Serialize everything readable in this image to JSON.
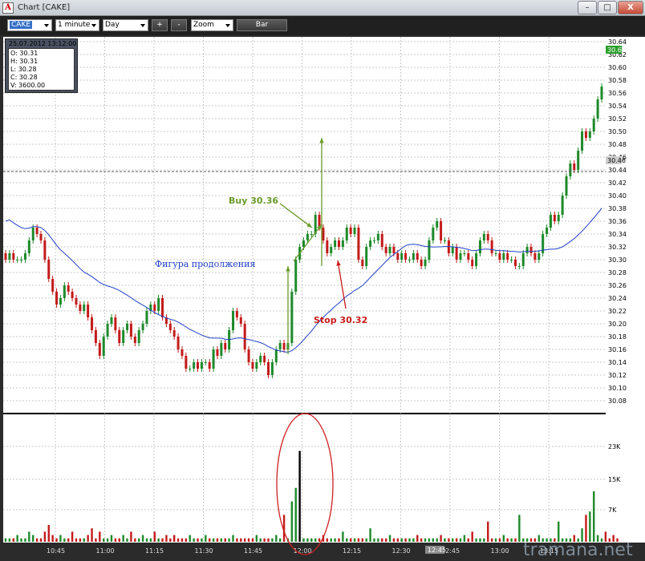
{
  "window": {
    "title": "Chart [CAKE]",
    "app_letter": "A",
    "min": "–",
    "max": "□",
    "close": "X"
  },
  "toolbar": {
    "symbol": "CAKE",
    "interval": "1 minute",
    "range": "Day",
    "plus": "+",
    "minus": "-",
    "zoom": "Zoom",
    "bar": "Bar"
  },
  "info": {
    "timestamp": "25.07.2012 13:12:00",
    "open": "O: 30.31",
    "high": "H: 30.31",
    "low": "L: 30.28",
    "close": "C: 30.28",
    "volume": "V: 3600.00"
  },
  "annotations": {
    "buy": "Buy 30.36",
    "stop": "Stop 30.32",
    "pattern": "Фигура продолжения",
    "last_price": "30.63",
    "crosshair_price": "30.46",
    "crosshair_time": "12:45"
  },
  "watermark": "tramana.net",
  "colors": {
    "up": "#1d8a2a",
    "down": "#c41a1a",
    "ma": "#2040c8",
    "buy": "#6a9a2a",
    "stop": "#cc1a1a"
  },
  "chart_data": {
    "type": "candlestick",
    "price_axis": {
      "min": 30.08,
      "max": 30.64,
      "step": 0.02,
      "ticks": [
        "30.64",
        "30.62",
        "30.60",
        "30.58",
        "30.56",
        "30.54",
        "30.52",
        "30.50",
        "30.48",
        "30.46",
        "30.44",
        "30.42",
        "30.40",
        "30.38",
        "30.36",
        "30.34",
        "30.32",
        "30.30",
        "30.28",
        "30.26",
        "30.24",
        "30.22",
        "30.20",
        "30.18",
        "30.16",
        "30.14",
        "30.12",
        "30.10",
        "30.08"
      ]
    },
    "volume_axis": {
      "ticks": [
        "23K",
        "15K",
        "7K"
      ]
    },
    "time_axis": [
      "10:45",
      "11:00",
      "11:15",
      "11:30",
      "11:45",
      "12:00",
      "12:15",
      "12:30",
      "12:45",
      "13:00",
      "13:15"
    ],
    "closes": [
      30.3,
      30.31,
      30.3,
      30.3,
      30.3,
      30.31,
      30.33,
      30.35,
      30.34,
      30.33,
      30.3,
      30.27,
      30.25,
      30.23,
      30.24,
      30.26,
      30.25,
      30.24,
      30.23,
      30.22,
      30.23,
      30.21,
      30.19,
      30.17,
      30.15,
      30.18,
      30.2,
      30.21,
      30.19,
      30.17,
      30.19,
      30.2,
      30.18,
      30.17,
      30.19,
      30.2,
      30.22,
      30.23,
      30.22,
      30.24,
      30.21,
      30.2,
      30.19,
      30.18,
      30.16,
      30.15,
      30.13,
      30.13,
      30.14,
      30.13,
      30.14,
      30.14,
      30.13,
      30.16,
      30.15,
      30.17,
      30.16,
      30.19,
      30.22,
      30.21,
      30.2,
      30.16,
      30.14,
      30.13,
      30.14,
      30.15,
      30.14,
      30.12,
      30.14,
      30.16,
      30.17,
      30.16,
      30.17,
      30.25,
      30.3,
      30.32,
      30.33,
      30.34,
      30.34,
      30.37,
      30.35,
      30.33,
      30.31,
      30.32,
      30.33,
      30.32,
      30.33,
      30.35,
      30.34,
      30.35,
      30.3,
      30.29,
      30.32,
      30.33,
      30.33,
      30.34,
      30.32,
      30.31,
      30.32,
      30.31,
      30.3,
      30.31,
      30.3,
      30.3,
      30.31,
      30.3,
      30.29,
      30.3,
      30.33,
      30.35,
      30.36,
      30.33,
      30.33,
      30.31,
      30.32,
      30.3,
      30.31,
      30.31,
      30.3,
      30.29,
      30.31,
      30.33,
      30.34,
      30.33,
      30.31,
      30.31,
      30.3,
      30.31,
      30.3,
      30.3,
      30.29,
      30.29,
      30.31,
      30.32,
      30.31,
      30.3,
      30.31,
      30.34,
      30.35,
      30.37,
      30.36,
      30.37,
      30.4,
      30.43,
      30.45,
      30.44,
      30.47,
      30.5,
      30.49,
      30.5,
      30.52,
      30.55,
      30.57
    ],
    "volumes": [
      1,
      1,
      1,
      2,
      1,
      1,
      3,
      2,
      1,
      1,
      3,
      5,
      2,
      1,
      2,
      1,
      1,
      3,
      1,
      1,
      1,
      2,
      4,
      1,
      3,
      1,
      1,
      2,
      1,
      1,
      2,
      1,
      3,
      1,
      1,
      2,
      1,
      1,
      3,
      1,
      1,
      2,
      1,
      2,
      1,
      1,
      1,
      2,
      1,
      1,
      1,
      2,
      1,
      1,
      1,
      1,
      1,
      1,
      2,
      1,
      1,
      1,
      1,
      1,
      2,
      1,
      1,
      1,
      1,
      2,
      1,
      8,
      1,
      12,
      16,
      27,
      1,
      1,
      1,
      1,
      1,
      2,
      1,
      1,
      1,
      1,
      3,
      1,
      1,
      1,
      1,
      1,
      1,
      4,
      1,
      1,
      1,
      1,
      2,
      1,
      1,
      1,
      1,
      1,
      1,
      2,
      1,
      1,
      1,
      1,
      1,
      2,
      1,
      1,
      1,
      1,
      1,
      2,
      1,
      3,
      1,
      1,
      1,
      6,
      1,
      1,
      1,
      2,
      1,
      1,
      1,
      8,
      1,
      1,
      1,
      1,
      2,
      1,
      1,
      1,
      1,
      6,
      1,
      1,
      1,
      2,
      1,
      4,
      8,
      9,
      15,
      2,
      1,
      3,
      1,
      2,
      1
    ]
  }
}
